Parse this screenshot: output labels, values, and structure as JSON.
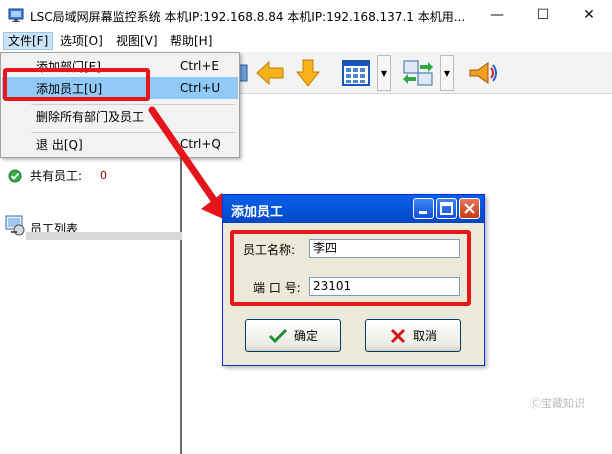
{
  "window": {
    "title": "LSC局域网屏幕监控系统   本机IP:192.168.8.84  本机IP:192.168.137.1   本机用...",
    "minimize_glyph": "—",
    "maximize_glyph": "☐",
    "close_glyph": "✕"
  },
  "menubar": {
    "items": [
      "文件[F]",
      "选项[O]",
      "视图[V]",
      "帮助[H]"
    ]
  },
  "file_menu": {
    "items": [
      {
        "label": "添加部门[E]",
        "shortcut": "Ctrl+E"
      },
      {
        "label": "添加员工[U]",
        "shortcut": "Ctrl+U"
      },
      {
        "label": "删除所有部门及员工",
        "shortcut": ""
      },
      {
        "label": "退 出[Q]",
        "shortcut": "Ctrl+Q"
      }
    ]
  },
  "left_panel": {
    "total_label": "共有员工:",
    "total_value": "0",
    "employee_list_label": "员工列表"
  },
  "dialog": {
    "title": "添加员工",
    "name_label": "员工名称:",
    "name_value": "李四",
    "port_label": "端 口 号:",
    "port_value": "23101",
    "ok_label": "确定",
    "cancel_label": "取消"
  },
  "watermark": "Ⓒ宝藏知识",
  "colors": {
    "highlight_box": "#e4151b",
    "menu_highlight": "#91c9f7",
    "dialog_title": "#0453d8",
    "dialog_body": "#ece9d8"
  },
  "icons": {
    "app": "monitor-app-icon",
    "toolbar": [
      "toolbar-partial-icon",
      "back-arrow-icon",
      "down-arrow-icon",
      "grid-view-icon",
      "transfer-icon",
      "broadcast-icon"
    ],
    "ok": "checkmark-icon",
    "cancel": "cross-icon",
    "status": "green-check-icon",
    "list": "employee-list-icon"
  }
}
